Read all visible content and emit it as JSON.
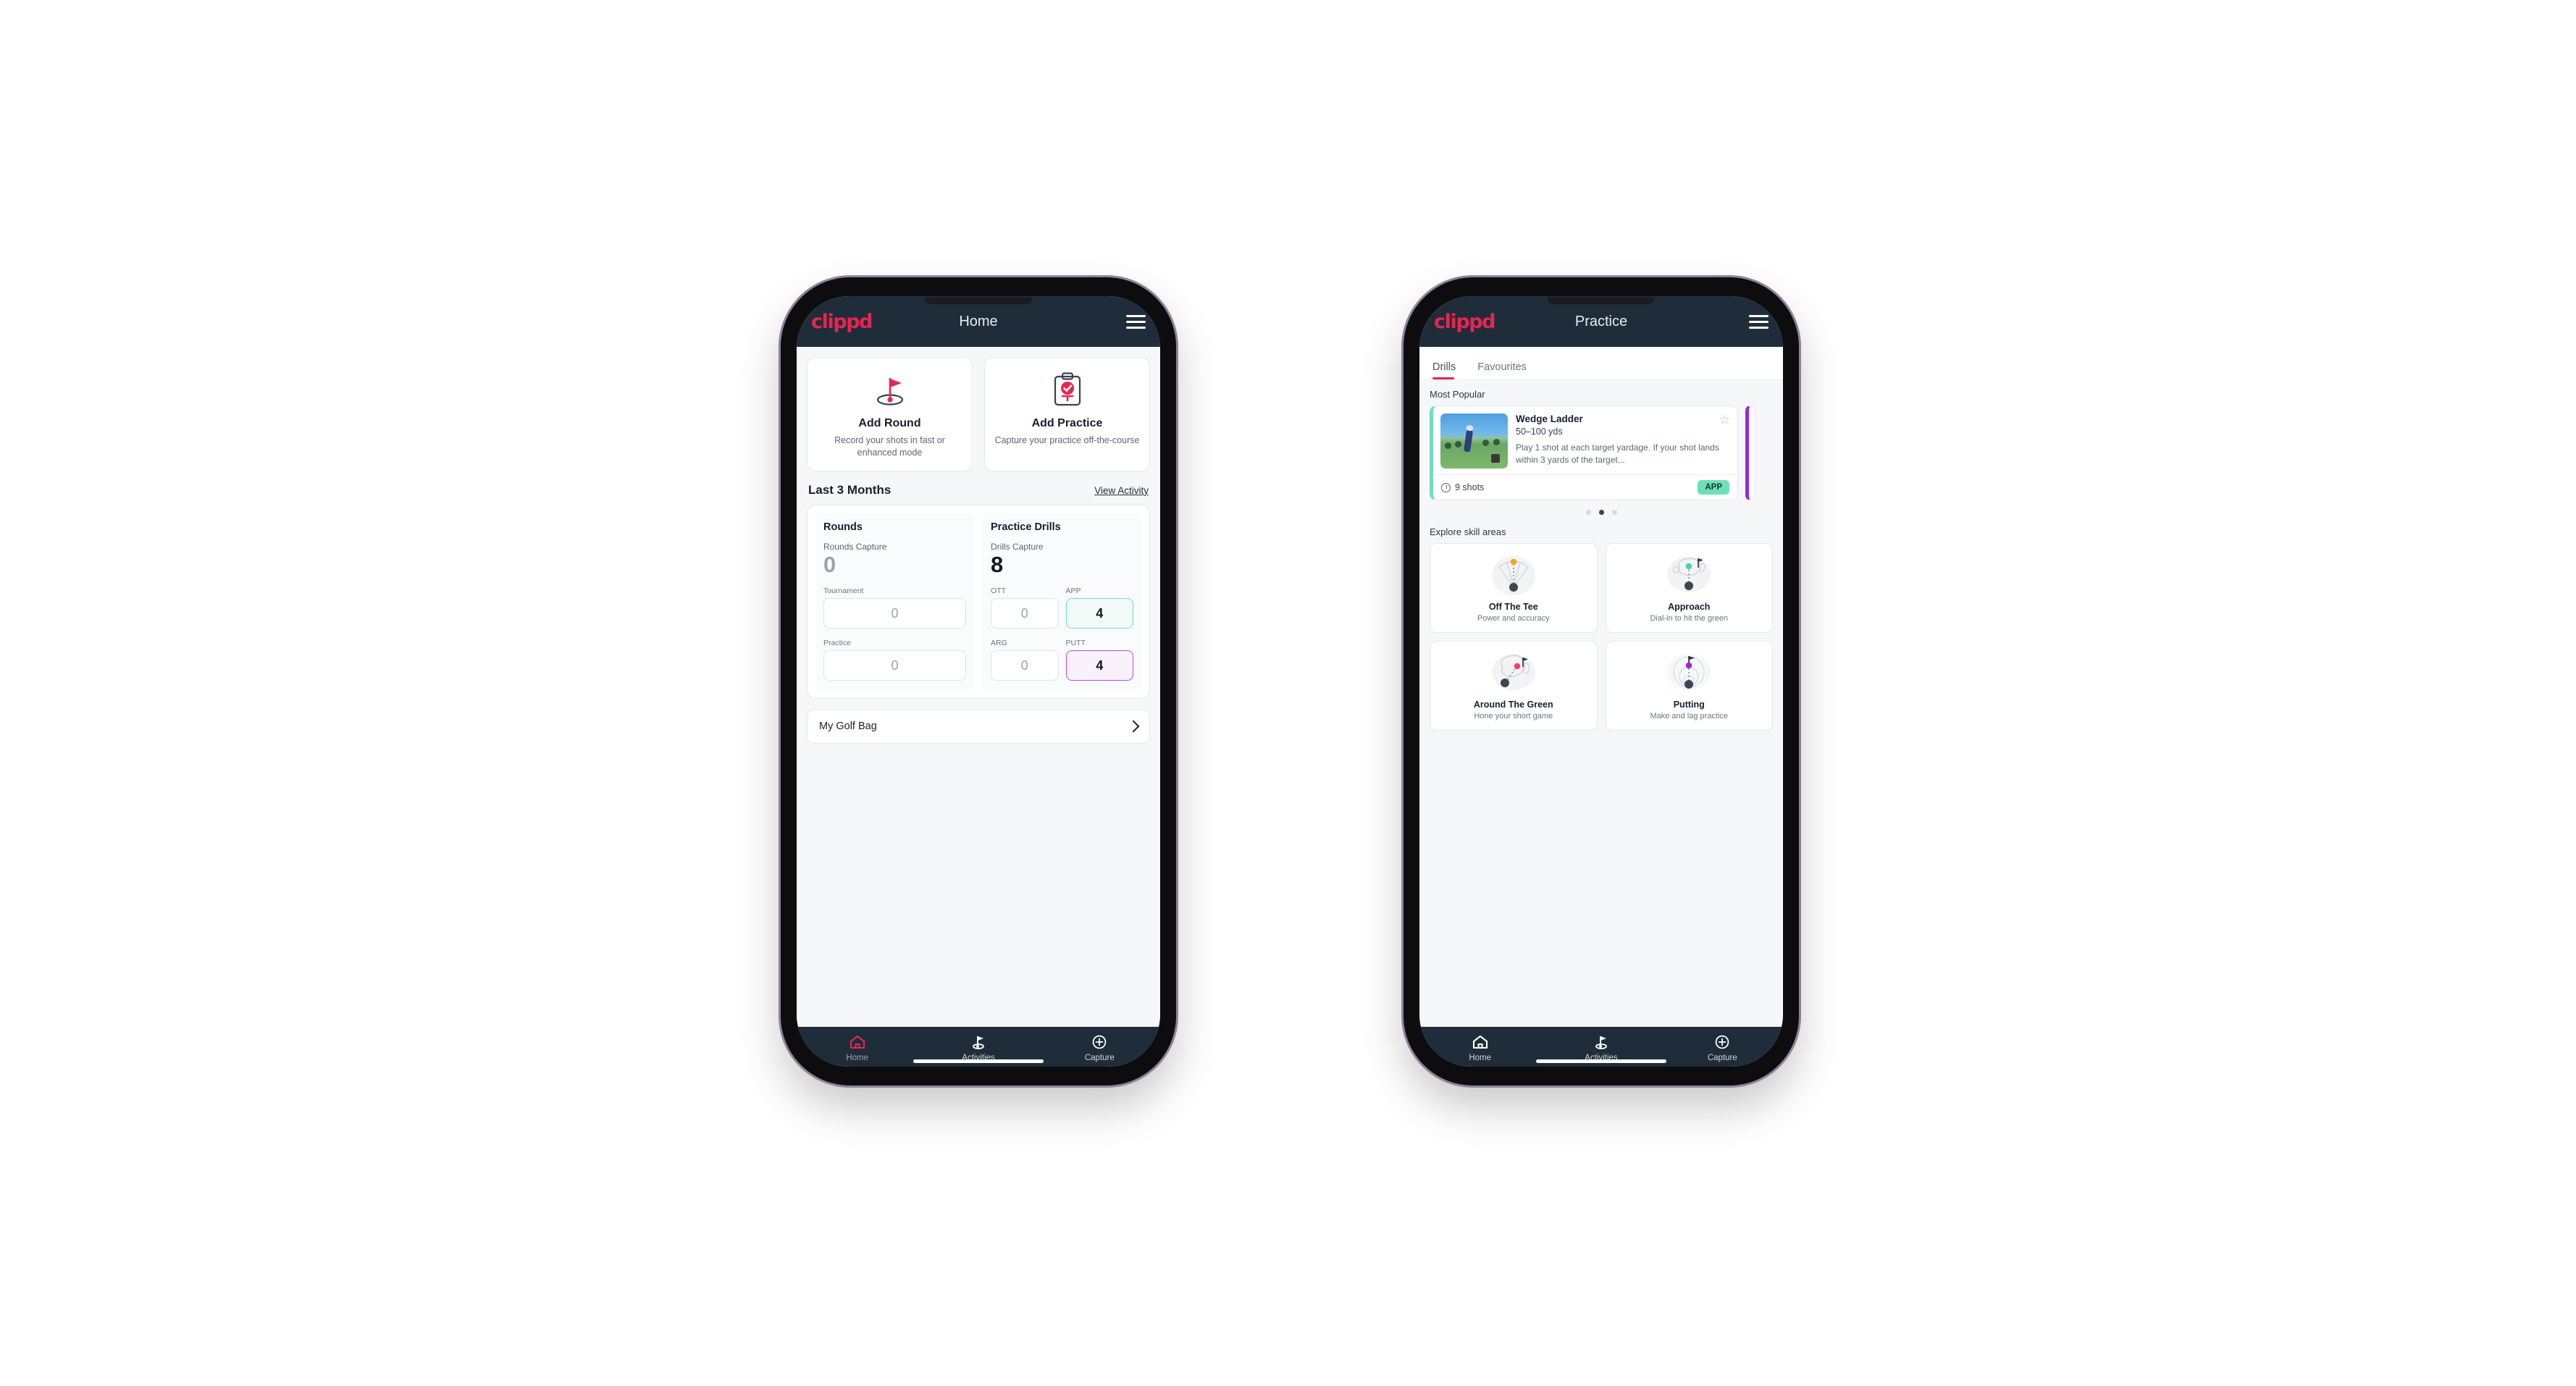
{
  "phone1": {
    "appbar": {
      "brand": "clippd",
      "title": "Home",
      "menu_icon": "hamburger-icon"
    },
    "quick_actions": [
      {
        "icon": "golf-flag-icon",
        "title": "Add Round",
        "subtitle": "Record your shots in fast or enhanced mode"
      },
      {
        "icon": "clipboard-check-icon",
        "title": "Add Practice",
        "subtitle": "Capture your practice off-the-course"
      }
    ],
    "section": {
      "title": "Last 3 Months",
      "link": "View Activity"
    },
    "rounds": {
      "heading": "Rounds",
      "capture_label": "Rounds Capture",
      "capture_value": "0",
      "fields": [
        {
          "label": "Tournament",
          "value": "0",
          "state": "empty"
        },
        {
          "label": "Practice",
          "value": "0",
          "state": "empty"
        }
      ]
    },
    "drills": {
      "heading": "Practice Drills",
      "capture_label": "Drills Capture",
      "capture_value": "8",
      "fields": [
        {
          "label": "OTT",
          "value": "0",
          "state": "empty"
        },
        {
          "label": "APP",
          "value": "4",
          "state": "app"
        },
        {
          "label": "ARG",
          "value": "0",
          "state": "empty"
        },
        {
          "label": "PUTT",
          "value": "4",
          "state": "putt"
        }
      ]
    },
    "golf_bag": {
      "label": "My Golf Bag",
      "icon": "chevron-right-icon"
    },
    "bottom_nav": [
      {
        "icon": "home-icon",
        "label": "Home",
        "active": true
      },
      {
        "icon": "golf-flag-icon",
        "label": "Activities",
        "active": false
      },
      {
        "icon": "plus-circle-icon",
        "label": "Capture",
        "active": false
      }
    ]
  },
  "phone2": {
    "appbar": {
      "brand": "clippd",
      "title": "Practice",
      "menu_icon": "hamburger-icon"
    },
    "tabs": [
      {
        "label": "Drills",
        "active": true
      },
      {
        "label": "Favourites",
        "active": false
      }
    ],
    "most_popular_label": "Most Popular",
    "featured_drill": {
      "title": "Wedge Ladder",
      "yardage": "50–100 yds",
      "description": "Play 1 shot at each target yardage. If your shot lands within 3 yards of the target...",
      "shots": "9 shots",
      "chip": "APP",
      "star_icon": "star-outline-icon",
      "clock_icon": "clock-icon",
      "accent": "#6fdfba",
      "next_accent": "#9b27d6"
    },
    "carousel_dots": {
      "count": 3,
      "active_index": 1
    },
    "skill_head": "Explore skill areas",
    "skill_areas": [
      {
        "icon": "tee-fan-icon",
        "name": "Off The Tee",
        "subtitle": "Power and accuracy",
        "dot_color": "#f5a623"
      },
      {
        "icon": "green-approach-icon",
        "name": "Approach",
        "subtitle": "Dial-in to hit the green",
        "dot_color": "#3fd6a8"
      },
      {
        "icon": "chip-green-icon",
        "name": "Around The Green",
        "subtitle": "Hone your short game",
        "dot_color": "#ef4266"
      },
      {
        "icon": "putting-rings-icon",
        "name": "Putting",
        "subtitle": "Make and lag practice",
        "dot_color": "#a020e0"
      }
    ],
    "bottom_nav": [
      {
        "icon": "home-icon",
        "label": "Home",
        "active": false
      },
      {
        "icon": "golf-flag-icon",
        "label": "Activities",
        "active": false
      },
      {
        "icon": "plus-circle-icon",
        "label": "Capture",
        "active": false
      }
    ]
  },
  "colors": {
    "brand_pink": "#e8254f",
    "header_navy": "#1f2d3a",
    "app_green": "#6fdfba",
    "putt_purple": "#b44fd8",
    "page_bg": "#f6f7f9"
  }
}
